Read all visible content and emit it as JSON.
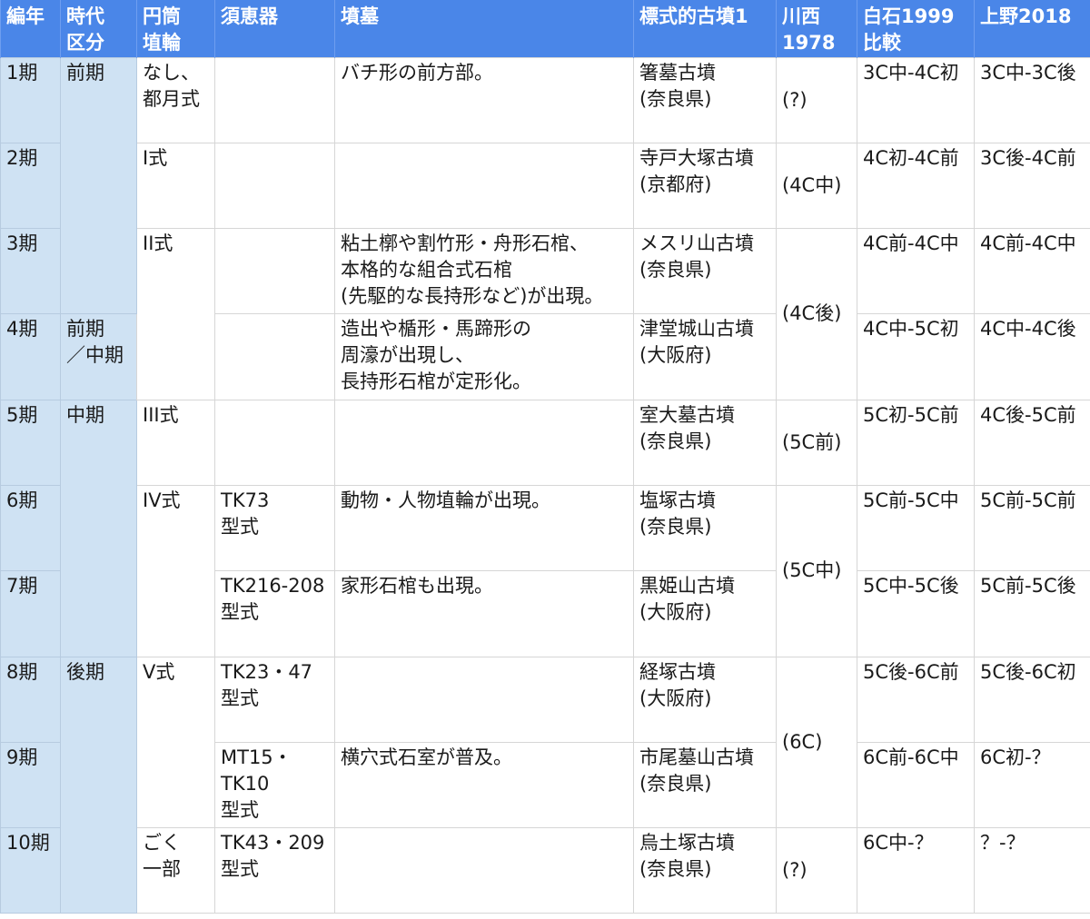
{
  "headers": [
    "編年",
    "時代\n区分",
    "円筒\n埴輪",
    "須恵器",
    "墳墓",
    "標式的古墳1",
    "川西\n1978",
    "白石1999\n比較",
    "上野2018"
  ],
  "periods": [
    "1期",
    "2期",
    "3期",
    "4期",
    "5期",
    "6期",
    "7期",
    "8期",
    "9期",
    "10期"
  ],
  "era": {
    "early": "前期",
    "early_middle": "前期\n／中期",
    "middle": "中期",
    "late": "後期"
  },
  "haniwa": {
    "p1": "なし、\n都月式",
    "p2": "I式",
    "p3": "II式",
    "p5": "III式",
    "p6": "IV式",
    "p8": "V式",
    "p10": "ごく\n一部"
  },
  "sueki": {
    "p6": "TK73\n型式",
    "p7": "TK216-208\n型式",
    "p8": "TK23・47\n型式",
    "p9": "MT15・\nTK10\n型式",
    "p10": "TK43・209\n型式"
  },
  "tombs": {
    "p1": "バチ形の前方部。",
    "p3": "粘土槨や割竹形・舟形石棺、\n本格的な組合式石棺\n(先駆的な長持形など)が出現。",
    "p4": "造出や楯形・馬蹄形の\n周濠が出現し、\n長持形石棺が定形化。",
    "p6": "動物・人物埴輪が出現。",
    "p7": "家形石棺も出現。",
    "p9": "横穴式石室が普及。"
  },
  "kofun": [
    "箸墓古墳\n(奈良県)",
    "寺戸大塚古墳\n(京都府)",
    "メスリ山古墳\n(奈良県)",
    "津堂城山古墳\n(大阪府)",
    "室大墓古墳\n(奈良県)",
    "塩塚古墳\n(奈良県)",
    "黒姫山古墳\n(大阪府)",
    "経塚古墳\n(大阪府)",
    "市尾墓山古墳\n(奈良県)",
    "烏土塚古墳\n(奈良県)"
  ],
  "kawanishi": {
    "p1": "(?)",
    "p2": "(4C中)",
    "p3_4": "(4C後)",
    "p5": "(5C前)",
    "p6_7": "(5C中)",
    "p8_9": "(6C)",
    "p10": "(?)"
  },
  "shiraishi": [
    "3C中-4C初",
    "4C初-4C前",
    "4C前-4C中",
    "4C中-5C初",
    "5C初-5C前",
    "5C前-5C中",
    "5C中-5C後",
    "5C後-6C前",
    "6C前-6C中",
    "6C中-？"
  ],
  "ueno": [
    "3C中-3C後",
    "3C後-4C前",
    "4C前-4C中",
    "4C中-4C後",
    "4C後-5C前",
    "5C前-5C前",
    "5C前-5C後",
    "5C後-6C初",
    "6C初-？",
    "？-？"
  ]
}
